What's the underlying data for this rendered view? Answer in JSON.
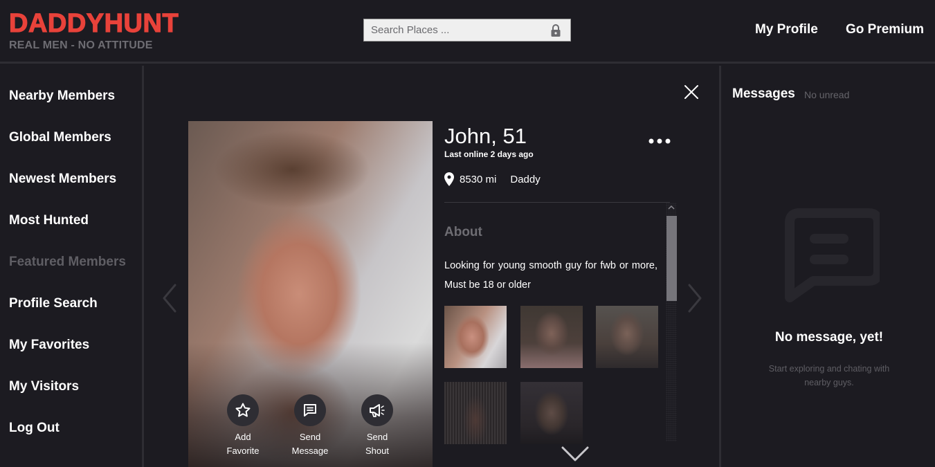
{
  "header": {
    "logo": "DADDYHUNT",
    "tagline": "REAL MEN - NO ATTITUDE",
    "search": {
      "placeholder": "Search Places ...",
      "value": "",
      "icon": "lock-icon"
    },
    "nav": [
      {
        "label": "My Profile"
      },
      {
        "label": "Go Premium"
      }
    ]
  },
  "sidebar": {
    "items": [
      {
        "label": "Nearby Members",
        "enabled": true
      },
      {
        "label": "Global Members",
        "enabled": true
      },
      {
        "label": "Newest Members",
        "enabled": true
      },
      {
        "label": "Most Hunted",
        "enabled": true
      },
      {
        "label": "Featured Members",
        "enabled": false
      },
      {
        "label": "Profile Search",
        "enabled": true
      },
      {
        "label": "My Favorites",
        "enabled": true
      },
      {
        "label": "My Visitors",
        "enabled": true
      },
      {
        "label": "Log Out",
        "enabled": true
      }
    ]
  },
  "profile": {
    "name_age": "John, 51",
    "last_online": "Last online 2 days ago",
    "distance": "8530 mi",
    "role": "Daddy",
    "about_title": "About",
    "about_text": "Looking for young smooth guy for fwb or more, Must be 18 or older",
    "actions": [
      {
        "line1": "Add",
        "line2": "Favorite",
        "icon": "star-icon"
      },
      {
        "line1": "Send",
        "line2": "Message",
        "icon": "message-icon"
      },
      {
        "line1": "Send",
        "line2": "Shout",
        "icon": "megaphone-icon"
      }
    ],
    "photo_count": 5
  },
  "messages": {
    "title": "Messages",
    "unread_status": "No unread",
    "empty_title": "No message, yet!",
    "empty_subtitle": "Start exploring and chating with nearby guys."
  },
  "colors": {
    "brand": "#e8423a",
    "background": "#1c1b21",
    "divider": "#2e2d33",
    "muted": "#6e6d73"
  }
}
